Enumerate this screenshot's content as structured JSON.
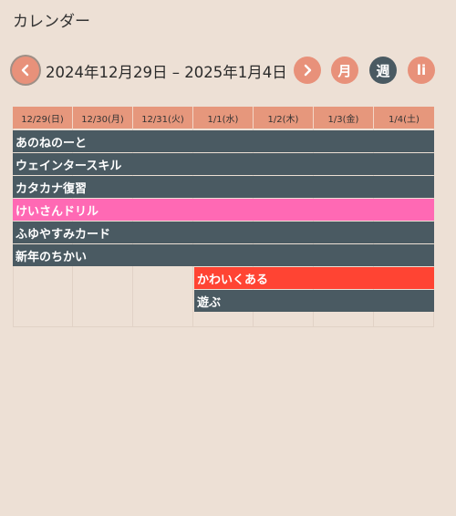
{
  "page_title": "カレンダー",
  "toolbar": {
    "range": "2024年12月29日 – 2025年1月4日",
    "month_label": "月",
    "week_label": "週",
    "list_label": "li"
  },
  "days": [
    "12/29(日)",
    "12/30(月)",
    "12/31(火)",
    "1/1(水)",
    "1/2(木)",
    "1/3(金)",
    "1/4(土)"
  ],
  "events": [
    {
      "title": "あのねのーと",
      "start": "12/29(日)",
      "end": "1/4(土)",
      "color": "#4a5a62"
    },
    {
      "title": "ウェインタースキル",
      "start": "12/29(日)",
      "end": "1/4(土)",
      "color": "#4a5a62"
    },
    {
      "title": "カタカナ復習",
      "start": "12/29(日)",
      "end": "1/4(土)",
      "color": "#4a5a62"
    },
    {
      "title": "けいさんドリル",
      "start": "12/29(日)",
      "end": "1/4(土)",
      "color": "#ff69b4"
    },
    {
      "title": "ふゆやすみカード",
      "start": "12/29(日)",
      "end": "1/4(土)",
      "color": "#4a5a62"
    },
    {
      "title": "新年のちかい",
      "start": "12/29(日)",
      "end": "1/4(土)",
      "color": "#4a5a62"
    },
    {
      "title": "かわいくある",
      "start": "1/1(水)",
      "end": "1/4(土)",
      "color": "#ff4433"
    },
    {
      "title": "遊ぶ",
      "start": "1/1(水)",
      "end": "1/4(土)",
      "color": "#4a5a62"
    }
  ]
}
